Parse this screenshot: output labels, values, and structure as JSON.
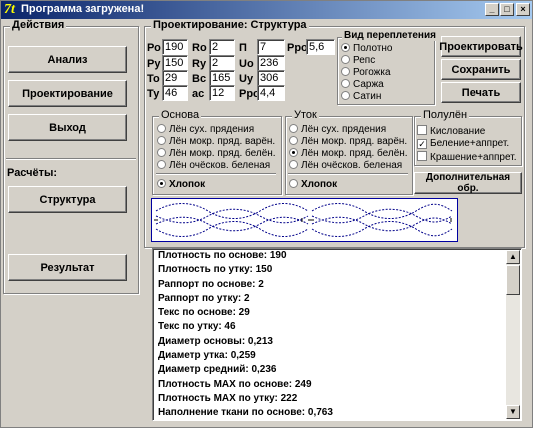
{
  "window": {
    "title": "Программа загружена!",
    "icon_glyph": "7t",
    "controls": [
      "_",
      "□",
      "×"
    ]
  },
  "actions": {
    "title": "Действия",
    "buttons": [
      "Анализ",
      "Проектирование",
      "Выход"
    ],
    "calc_label": "Расчёты:",
    "structure_button": "Структура",
    "result_button": "Результат"
  },
  "design": {
    "title": "Проектирование: Структура",
    "params": [
      {
        "label": "Ро",
        "value": "190"
      },
      {
        "label": "Ру",
        "value": "150"
      },
      {
        "label": "То",
        "value": "29"
      },
      {
        "label": "Ту",
        "value": "46"
      },
      {
        "label": "Ro",
        "value": "2"
      },
      {
        "label": "Ry",
        "value": "2"
      },
      {
        "label": "Bc",
        "value": "165"
      },
      {
        "label": "ac",
        "value": "12"
      },
      {
        "label": "П",
        "value": "7"
      },
      {
        "label": "Uo",
        "value": "236"
      },
      {
        "label": "Uy",
        "value": "306"
      },
      {
        "label": "Ppo",
        "value": "4,4"
      },
      {
        "label": "Рро",
        "value": "5,6"
      }
    ],
    "weave": {
      "title": "Вид переплетения",
      "options": [
        "Полотно",
        "Репс",
        "Рогожка",
        "Саржа",
        "Сатин"
      ],
      "selected": "Полотно"
    },
    "buttons": {
      "design": "Проектировать",
      "save": "Сохранить",
      "print": "Печать",
      "extra": "Дополнительная обр."
    }
  },
  "warp": {
    "title": "Основа",
    "options": [
      "Лён сух. прядения",
      "Лён мокр. пряд. варён.",
      "Лён мокр. пряд. белён.",
      "Лён очёсков. беленая"
    ],
    "cotton": "Хлопок",
    "selected": "Хлопок"
  },
  "weft": {
    "title": "Уток",
    "options": [
      "Лён сух. прядения",
      "Лён мокр. пряд. варён.",
      "Лён мокр. пряд. белён.",
      "Лён очёсков. беленая"
    ],
    "cotton": "Хлопок",
    "selected": "Лён мокр. пряд. белён."
  },
  "finish": {
    "title": "Полулён",
    "options": [
      {
        "label": "Кислование",
        "checked": false
      },
      {
        "label": "Беление+аппрет.",
        "checked": true
      },
      {
        "label": "Крашение+аппрет.",
        "checked": false
      }
    ]
  },
  "results": [
    "Плотность по основе: 190",
    "Плотность по утку: 150",
    "Раппорт по основе: 2",
    "Раппорт по утку: 2",
    "Текс по основе: 29",
    "Текс по утку: 46",
    "Диаметр основы: 0,213",
    "Диаметр утка: 0,259",
    "Диаметр средний: 0,236",
    "Плотность MAX по основе: 249",
    "Плотность MAX по утку: 222",
    "Наполнение ткани по основе: 0,763"
  ],
  "colors": {
    "title_bar": "#0a246a",
    "face": "#d4d0c8",
    "preview_border": "#0000a0"
  }
}
